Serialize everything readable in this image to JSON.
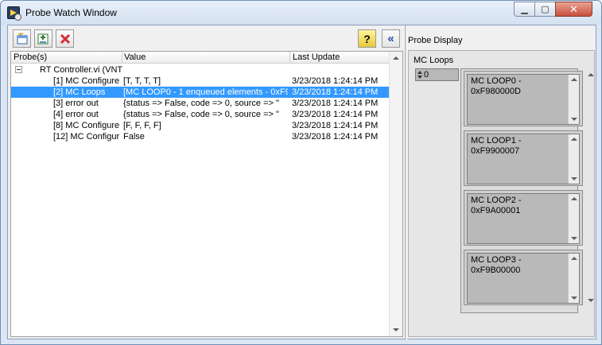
{
  "window": {
    "title": "Probe Watch Window"
  },
  "toolbar": {
    "help_label": "?",
    "collapse_label": "«"
  },
  "tree": {
    "columns": [
      "Probe(s)",
      "Value",
      "Last Update"
    ],
    "root": "RT Controller.vi (VNT",
    "rows": [
      {
        "probe": "[1] MC Configure",
        "value": "[T, T, T, T]",
        "updated": "3/23/2018 1:24:14 PM"
      },
      {
        "probe": "[2] MC Loops",
        "value": "[MC LOOP0 - 1 enqueued elements - 0xF98",
        "updated": "3/23/2018 1:24:14 PM"
      },
      {
        "probe": "[3] error out",
        "value": "{status => False, code => 0, source => \"",
        "updated": "3/23/2018 1:24:14 PM"
      },
      {
        "probe": "[4] error out",
        "value": "{status => False, code => 0, source => \"",
        "updated": "3/23/2018 1:24:14 PM"
      },
      {
        "probe": "[8] MC Configure",
        "value": "[F, F, F, F]",
        "updated": "3/23/2018 1:24:14 PM"
      },
      {
        "probe": "[12] MC Configur",
        "value": "False",
        "updated": "3/23/2018 1:24:14 PM"
      }
    ]
  },
  "probe_display": {
    "label": "Probe Display",
    "array_label": "MC Loops",
    "index": "0",
    "elements": [
      "MC LOOP0 -\n0xF980000D",
      "MC LOOP1 -\n0xF9900007",
      "MC LOOP2 -\n0xF9A00001",
      "MC LOOP3 -\n0xF9B00000"
    ]
  }
}
